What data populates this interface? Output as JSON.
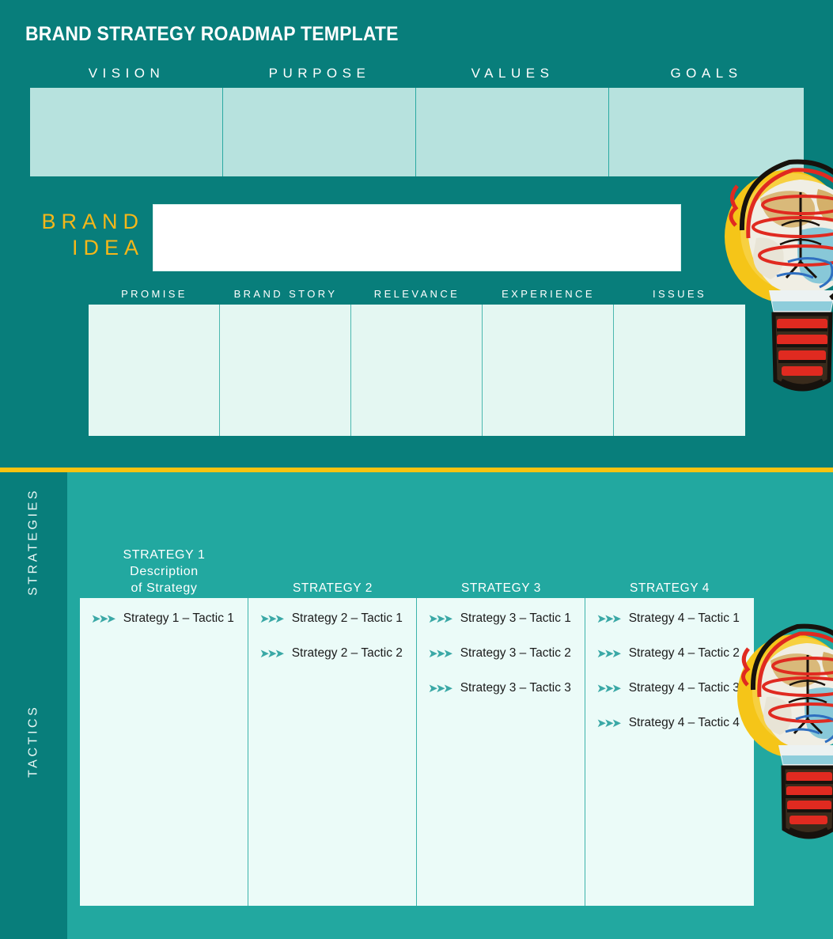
{
  "document": {
    "title": "BRAND STRATEGY ROADMAP TEMPLATE"
  },
  "colors": {
    "dark_teal": "#087e7b",
    "mid_teal": "#22a8a0",
    "gold": "#f8c310",
    "brand_idea_gold": "#f5b719",
    "pillar_box": "#b7e2de",
    "sub_box": "#e4f7f2",
    "tactic_box": "#ebfbf8",
    "white": "#ffffff"
  },
  "pillars": {
    "headers": [
      "VISION",
      "PURPOSE",
      "VALUES",
      "GOALS"
    ]
  },
  "brand_idea": {
    "label_line1": "BRAND",
    "label_line2": "IDEA",
    "input_value": "",
    "input_placeholder": ""
  },
  "sub_pillars": {
    "headers": [
      "PROMISE",
      "BRAND STORY",
      "RELEVANCE",
      "EXPERIENCE",
      "ISSUES"
    ]
  },
  "rail": {
    "strategies_label": "STRATEGIES",
    "tactics_label": "TACTICS"
  },
  "strategies": [
    {
      "heading_lines": [
        "STRATEGY 1",
        "Description",
        "of Strategy"
      ],
      "tactics": [
        "Strategy 1 – Tactic 1"
      ]
    },
    {
      "heading_lines": [
        "STRATEGY 2"
      ],
      "tactics": [
        "Strategy 2 – Tactic 1",
        "Strategy 2 – Tactic 2"
      ]
    },
    {
      "heading_lines": [
        "STRATEGY 3"
      ],
      "tactics": [
        "Strategy 3 – Tactic 1",
        "Strategy 3 – Tactic 2",
        "Strategy 3 – Tactic 3"
      ]
    },
    {
      "heading_lines": [
        "STRATEGY 4"
      ],
      "tactics": [
        "Strategy 4 – Tactic 1",
        "Strategy 4 – Tactic 2",
        "Strategy 4 – Tactic 3",
        "Strategy 4 – Tactic 4"
      ]
    }
  ],
  "icons": {
    "bullet": "chevron-triple-right-icon",
    "decoration": "lightbulb-globe-icon"
  }
}
